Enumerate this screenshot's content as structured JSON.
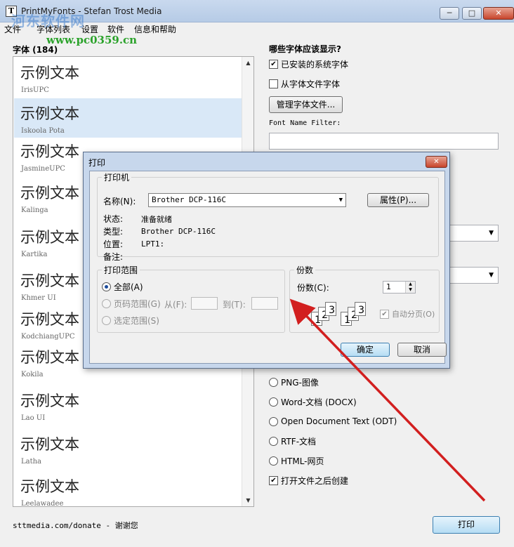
{
  "window": {
    "title": "PrintMyFonts - Stefan Trost Media",
    "minimize": "─",
    "maximize": "□",
    "close": "✕"
  },
  "watermark": {
    "text": "河东软件网",
    "url": "www.pc0359.cn"
  },
  "menu": [
    "文件",
    "字体列表",
    "设置",
    "软件",
    "信息和帮助"
  ],
  "font_list": {
    "header": "字体 (184)",
    "sample_text": "示例文本",
    "items": [
      {
        "name": "IrisUPC",
        "selected": false
      },
      {
        "name": "Iskoola Pota",
        "selected": true
      },
      {
        "name": "JasmineUPC",
        "selected": false
      },
      {
        "name": "Kalinga",
        "selected": false
      },
      {
        "name": "Kartika",
        "selected": false
      },
      {
        "name": "Khmer UI",
        "selected": false
      },
      {
        "name": "KodchiangUPC",
        "selected": false
      },
      {
        "name": "Kokila",
        "selected": false
      },
      {
        "name": "Lao UI",
        "selected": false
      },
      {
        "name": "Latha",
        "selected": false
      },
      {
        "name": "Leelawadee",
        "selected": false
      }
    ]
  },
  "options": {
    "which_fonts_title": "哪些字体应该显示?",
    "installed_label": "已安装的系统字体",
    "installed_checked": "✔",
    "from_file_label": "从字体文件字体",
    "from_file_checked": "",
    "manage_button": "管理字体文件...",
    "filter_label": "Font Name Filter:",
    "filter_value": "",
    "dropdown_arrow": "▼",
    "formats": [
      {
        "label": "PNG-图像",
        "selected": false
      },
      {
        "label": "Word-文档 (DOCX)",
        "selected": false
      },
      {
        "label": "Open Document Text (ODT)",
        "selected": false
      },
      {
        "label": "RTF-文档",
        "selected": false
      },
      {
        "label": "HTML-网页",
        "selected": false
      }
    ],
    "open_after_label": "打开文件之后创建",
    "open_after_checked": "✔"
  },
  "footer": {
    "donate": "sttmedia.com/donate - 谢谢您",
    "print_button": "打印"
  },
  "scroll": {
    "up": "▲",
    "down": "▼"
  },
  "print_dialog": {
    "title": "打印",
    "close": "✕",
    "printer_group": "打印机",
    "name_label": "名称(N):",
    "printer_name": "Brother DCP-116C",
    "properties_button": "属性(P)...",
    "status_label": "状态:",
    "status_value": "准备就绪",
    "type_label": "类型:",
    "type_value": "Brother DCP-116C",
    "where_label": "位置:",
    "where_value": "LPT1:",
    "comment_label": "备注:",
    "comment_value": "",
    "range_group": "打印范围",
    "all_label": "全部(A)",
    "pages_label": "页码范围(G)",
    "from_label": "从(F):",
    "to_label": "到(T):",
    "from_value": "",
    "to_value": "",
    "selection_label": "选定范围(S)",
    "copies_group": "份数",
    "copies_label": "份数(C):",
    "copies_value": "1",
    "collate_label": "自动分页(O)",
    "collate_checked": "✔",
    "collate_digits": [
      "1",
      "2",
      "3"
    ],
    "ok_button": "确定",
    "cancel_button": "取消"
  }
}
